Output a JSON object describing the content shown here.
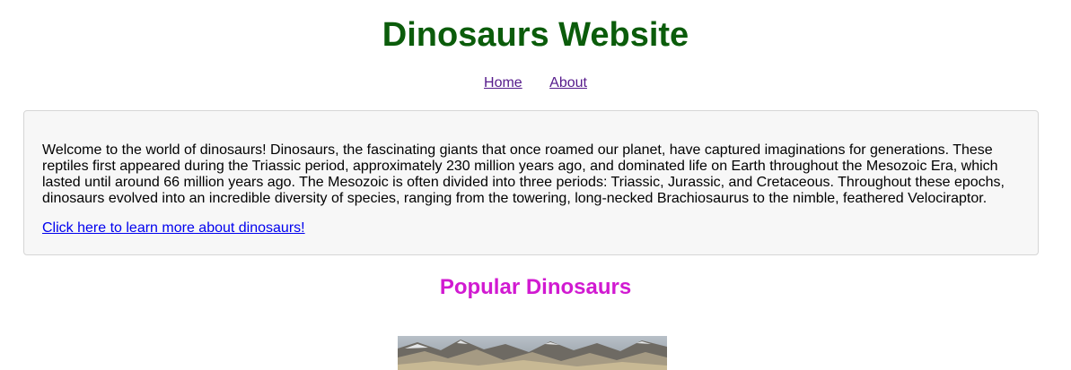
{
  "header": {
    "title": "Dinosaurs Website"
  },
  "nav": {
    "items": [
      {
        "label": "Home"
      },
      {
        "label": "About"
      }
    ]
  },
  "intro": {
    "text": "Welcome to the world of dinosaurs! Dinosaurs, the fascinating giants that once roamed our planet, have captured imaginations for generations. These reptiles first appeared during the Triassic period, approximately 230 million years ago, and dominated life on Earth throughout the Mesozoic Era, which lasted until around 66 million years ago. The Mesozoic is often divided into three periods: Triassic, Jurassic, and Cretaceous. Throughout these epochs, dinosaurs evolved into an incredible diversity of species, ranging from the towering, long-necked Brachiosaurus to the nimble, feathered Velociraptor.",
    "link_label": "Click here to learn more about dinosaurs!"
  },
  "popular": {
    "heading": "Popular Dinosaurs",
    "image_icon": "mountain-landscape-photo"
  },
  "colors": {
    "title": "#0b5c0b",
    "nav_link": "#551a8b",
    "intro_link": "#0000ee",
    "intro_background": "#f7f7f7",
    "intro_border": "#d6d6d6",
    "section_heading": "#d11ad1"
  }
}
